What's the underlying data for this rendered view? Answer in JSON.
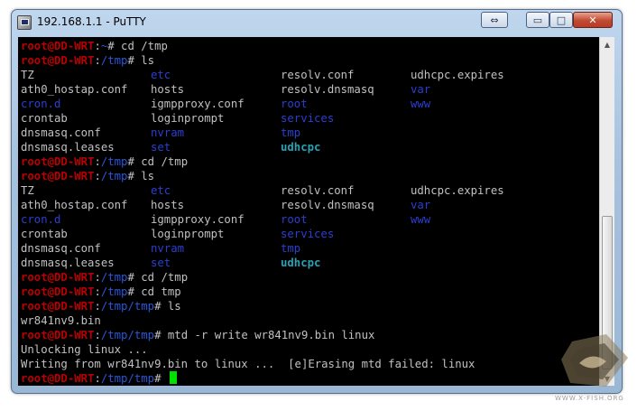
{
  "window": {
    "title": "192.168.1.1 - PuTTY",
    "controls": {
      "resize_icon": "⇔",
      "minimize_icon": "▭",
      "maximize_icon": "□",
      "close_icon": "✕"
    }
  },
  "colors": {
    "prompt_user": "#bb0000",
    "prompt_path": "#2a57d6",
    "directory": "#2a3fd0",
    "special": "#2aa0b2",
    "text": "#c0c0c0",
    "cursor": "#00e000"
  },
  "terminal": {
    "prompt_user": "root@DD-WRT",
    "lines": [
      {
        "type": "prompt",
        "path": "~",
        "cmd": " cd /tmp"
      },
      {
        "type": "prompt",
        "path": "/tmp",
        "cmd": " ls"
      },
      {
        "type": "ls",
        "cols": [
          {
            "t": "TZ",
            "k": "plain"
          },
          {
            "t": "etc",
            "k": "dir"
          },
          {
            "t": "resolv.conf",
            "k": "plain"
          },
          {
            "t": "udhcpc.expires",
            "k": "plain"
          }
        ]
      },
      {
        "type": "ls",
        "cols": [
          {
            "t": "ath0_hostap.conf",
            "k": "plain"
          },
          {
            "t": "hosts",
            "k": "plain"
          },
          {
            "t": "resolv.dnsmasq",
            "k": "plain"
          },
          {
            "t": "var",
            "k": "dir"
          }
        ]
      },
      {
        "type": "ls",
        "cols": [
          {
            "t": "cron.d",
            "k": "dir"
          },
          {
            "t": "igmpproxy.conf",
            "k": "plain"
          },
          {
            "t": "root",
            "k": "dir"
          },
          {
            "t": "www",
            "k": "dir"
          }
        ]
      },
      {
        "type": "ls",
        "cols": [
          {
            "t": "crontab",
            "k": "plain"
          },
          {
            "t": "loginprompt",
            "k": "plain"
          },
          {
            "t": "services",
            "k": "dir"
          },
          {
            "t": "",
            "k": "plain"
          }
        ]
      },
      {
        "type": "ls",
        "cols": [
          {
            "t": "dnsmasq.conf",
            "k": "plain"
          },
          {
            "t": "nvram",
            "k": "dir"
          },
          {
            "t": "tmp",
            "k": "dir"
          },
          {
            "t": "",
            "k": "plain"
          }
        ]
      },
      {
        "type": "ls",
        "cols": [
          {
            "t": "dnsmasq.leases",
            "k": "plain"
          },
          {
            "t": "set",
            "k": "dir"
          },
          {
            "t": "udhcpc",
            "k": "special"
          },
          {
            "t": "",
            "k": "plain"
          }
        ]
      },
      {
        "type": "prompt",
        "path": "/tmp",
        "cmd": " cd /tmp"
      },
      {
        "type": "prompt",
        "path": "/tmp",
        "cmd": " ls"
      },
      {
        "type": "ls",
        "cols": [
          {
            "t": "TZ",
            "k": "plain"
          },
          {
            "t": "etc",
            "k": "dir"
          },
          {
            "t": "resolv.conf",
            "k": "plain"
          },
          {
            "t": "udhcpc.expires",
            "k": "plain"
          }
        ]
      },
      {
        "type": "ls",
        "cols": [
          {
            "t": "ath0_hostap.conf",
            "k": "plain"
          },
          {
            "t": "hosts",
            "k": "plain"
          },
          {
            "t": "resolv.dnsmasq",
            "k": "plain"
          },
          {
            "t": "var",
            "k": "dir"
          }
        ]
      },
      {
        "type": "ls",
        "cols": [
          {
            "t": "cron.d",
            "k": "dir"
          },
          {
            "t": "igmpproxy.conf",
            "k": "plain"
          },
          {
            "t": "root",
            "k": "dir"
          },
          {
            "t": "www",
            "k": "dir"
          }
        ]
      },
      {
        "type": "ls",
        "cols": [
          {
            "t": "crontab",
            "k": "plain"
          },
          {
            "t": "loginprompt",
            "k": "plain"
          },
          {
            "t": "services",
            "k": "dir"
          },
          {
            "t": "",
            "k": "plain"
          }
        ]
      },
      {
        "type": "ls",
        "cols": [
          {
            "t": "dnsmasq.conf",
            "k": "plain"
          },
          {
            "t": "nvram",
            "k": "dir"
          },
          {
            "t": "tmp",
            "k": "dir"
          },
          {
            "t": "",
            "k": "plain"
          }
        ]
      },
      {
        "type": "ls",
        "cols": [
          {
            "t": "dnsmasq.leases",
            "k": "plain"
          },
          {
            "t": "set",
            "k": "dir"
          },
          {
            "t": "udhcpc",
            "k": "special"
          },
          {
            "t": "",
            "k": "plain"
          }
        ]
      },
      {
        "type": "prompt",
        "path": "/tmp",
        "cmd": " cd /tmp"
      },
      {
        "type": "prompt",
        "path": "/tmp",
        "cmd": " cd tmp"
      },
      {
        "type": "prompt",
        "path": "/tmp/tmp",
        "cmd": " ls"
      },
      {
        "type": "text",
        "text": "wr841nv9.bin"
      },
      {
        "type": "prompt",
        "path": "/tmp/tmp",
        "cmd": " mtd -r write wr841nv9.bin linux"
      },
      {
        "type": "text",
        "text": "Unlocking linux ..."
      },
      {
        "type": "text",
        "text": "Writing from wr841nv9.bin to linux ...  [e]Erasing mtd failed: linux"
      },
      {
        "type": "prompt",
        "path": "/tmp/tmp",
        "cmd": " ",
        "cursor": true
      }
    ]
  },
  "watermark": {
    "text": "WWW.X-FISH.ORG"
  }
}
